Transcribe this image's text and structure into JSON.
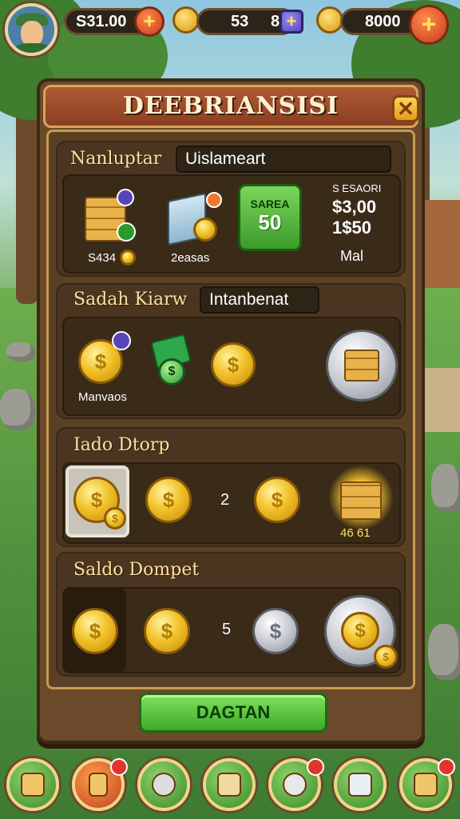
{
  "header": {
    "balance_left": "S31.00",
    "balance_mid": "53",
    "balance_mid_small": "8",
    "balance_right": "8000"
  },
  "panel": {
    "title": "DEEBRIANSISI",
    "close_label": "✕",
    "sections": [
      {
        "label": "Nanluptar",
        "tab": "Uislameart",
        "items": {
          "item1": "S434",
          "item2": "2easas",
          "sign_top": "SAREA",
          "sign_value": "50",
          "right_top": "S ESAORI",
          "right_line1": "$3,00",
          "right_line2": "1$50",
          "right_bottom": "Mal"
        }
      },
      {
        "label": "Sadah Kiarw",
        "tab": "Intanbenat",
        "items": {
          "coin_label": "Manvaos"
        }
      },
      {
        "label": "Iado Dtorp",
        "items": {
          "count": "2",
          "bundle_value": "46 61"
        }
      },
      {
        "label": "Saldo Dompet",
        "items": {
          "count": "5"
        }
      }
    ],
    "button_label": "DAGTAN"
  },
  "bottom_nav": [
    {
      "name": "chest-icon",
      "badge": false
    },
    {
      "name": "card-icon",
      "badge": true
    },
    {
      "name": "pet-icon",
      "badge": false
    },
    {
      "name": "map-icon",
      "badge": false
    },
    {
      "name": "character-icon",
      "badge": true
    },
    {
      "name": "mail-icon",
      "badge": false
    },
    {
      "name": "gift-icon",
      "badge": true
    }
  ],
  "colors": {
    "accent": "#3ea82a",
    "panel": "#6a4a2a",
    "gold": "#f2c22a",
    "title_bar": "#8a3f22"
  }
}
